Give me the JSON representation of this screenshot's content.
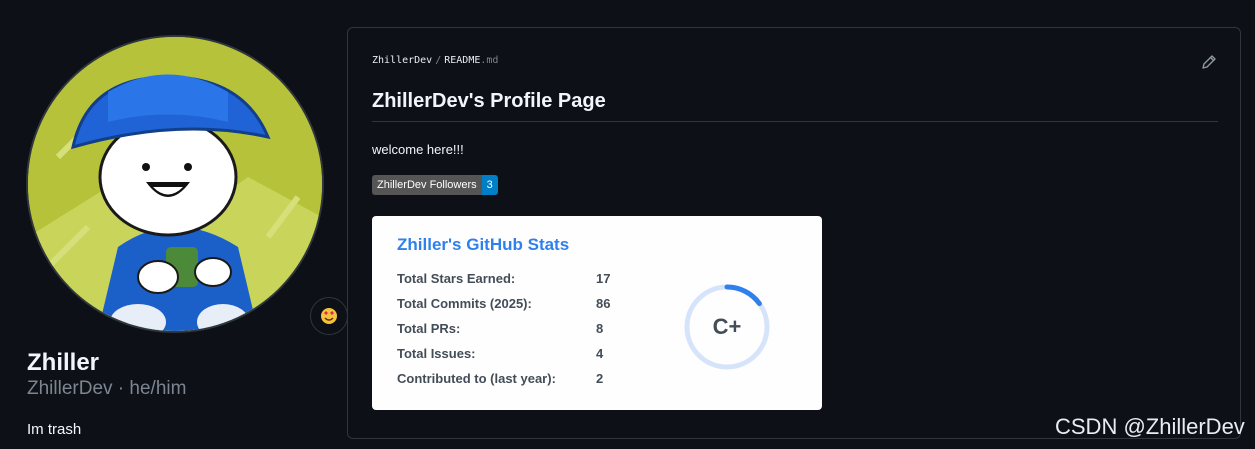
{
  "profile": {
    "display_name": "Zhiller",
    "login_line": "ZhillerDev · he/him",
    "bio": "Im trash",
    "status_emoji": "face-hearts-icon"
  },
  "readme": {
    "owner": "ZhillerDev",
    "separator": "/",
    "file": "README",
    "ext": ".md",
    "title": "ZhillerDev's Profile Page",
    "welcome": "welcome here!!!",
    "badge_label": "ZhillerDev Followers",
    "badge_value": "3"
  },
  "stats_card": {
    "title": "Zhiller's GitHub Stats",
    "rows": [
      {
        "label": "Total Stars Earned:",
        "value": "17"
      },
      {
        "label": "Total Commits (2025):",
        "value": "86"
      },
      {
        "label": "Total PRs:",
        "value": "8"
      },
      {
        "label": "Total Issues:",
        "value": "4"
      },
      {
        "label": "Contributed to (last year):",
        "value": "2"
      }
    ],
    "rank": "C+",
    "rank_progress": 0.15,
    "accent": "#2f80ed"
  },
  "watermark": "CSDN @ZhillerDev"
}
